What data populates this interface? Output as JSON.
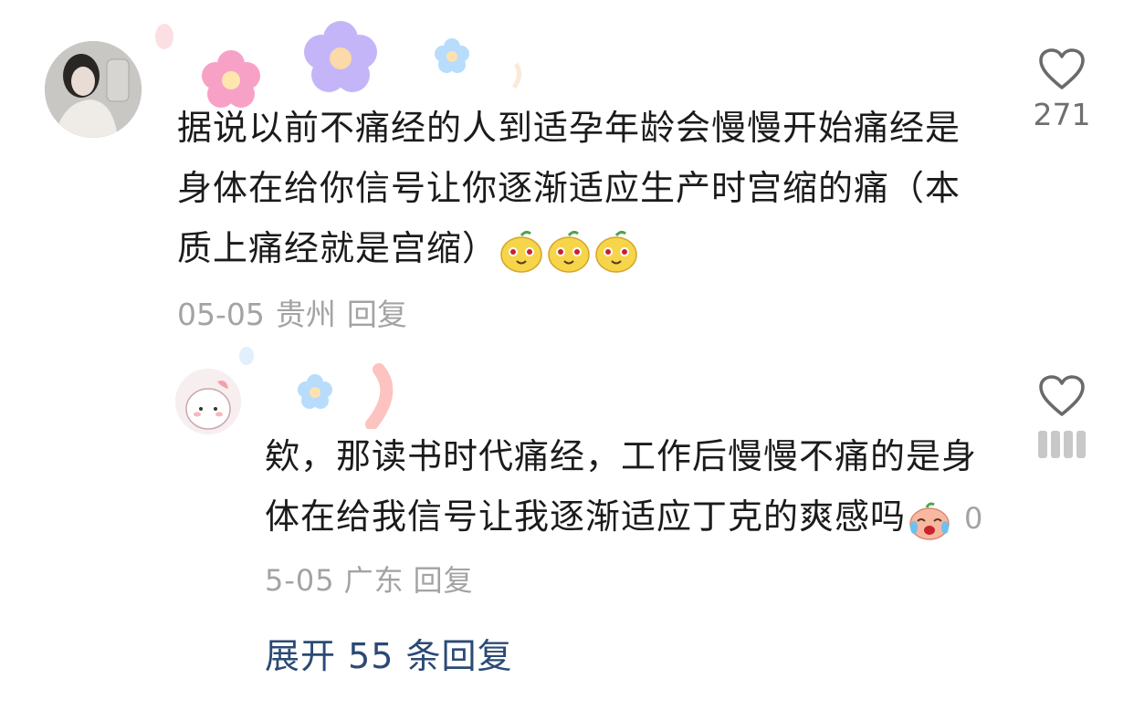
{
  "comments": [
    {
      "text": "据说以前不痛经的人到适孕年龄会慢慢开始痛经是身体在给你信号让你逐渐适应生产时宫缩的痛（本质上痛经就是宫缩）",
      "date": "05-05",
      "location": "贵州",
      "reply_label": "回复",
      "likes": "271",
      "emoji": "smiling-mango-emoji"
    },
    {
      "text": "欸，那读书时代痛经，工作后慢慢不痛的是身体在给我信号让我逐渐适应丁克的爽感吗",
      "date": "05-05",
      "location": "广东",
      "reply_label": "回复",
      "emoji": "laughing-tears-emoji"
    }
  ],
  "expand_label": "展开 55 条回复",
  "colors": {
    "text": "#1b1b1b",
    "meta": "#a3a3a3",
    "link": "#2b4a74"
  }
}
